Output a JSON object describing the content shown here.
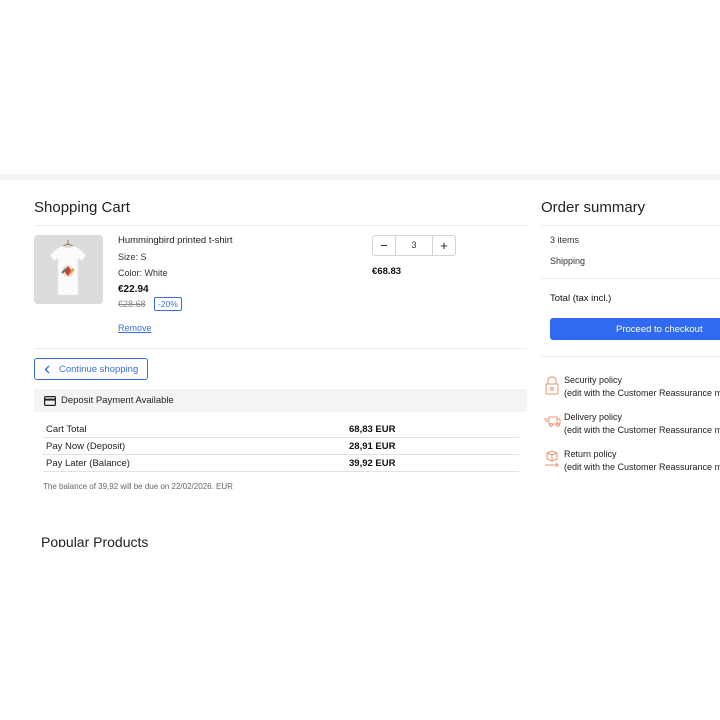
{
  "cart": {
    "title": "Shopping Cart",
    "product": {
      "name": "Hummingbird printed t-shirt",
      "size": "Size: S",
      "color": "Color: White",
      "price": "€22.94",
      "old_price": "€28.68",
      "discount": "-20%",
      "remove_label": "Remove",
      "quantity": "3",
      "line_total": "€68.83",
      "qty_minus": "−",
      "qty_plus": "+"
    },
    "continue_label": "Continue shopping",
    "deposit_label": "Deposit Payment Available",
    "deposit_rows": [
      {
        "label": "Cart Total",
        "value": "68,83 EUR"
      },
      {
        "label": "Pay Now (Deposit)",
        "value": "28,91 EUR"
      },
      {
        "label": "Pay Later (Balance)",
        "value": "39,92 EUR"
      }
    ],
    "balance_note": "The balance of 39,92 will be due on 22/02/2026. EUR"
  },
  "popular": {
    "title": "Popular Products"
  },
  "summary": {
    "title": "Order summary",
    "items": "3 items",
    "shipping": "Shipping",
    "total_label": "Total (tax incl.)",
    "checkout_label": "Proceed to checkout"
  },
  "reassurance": [
    {
      "title": "Security policy",
      "subtitle": "(edit with the Customer Reassurance module)",
      "icon": "lock-icon"
    },
    {
      "title": "Delivery policy",
      "subtitle": "(edit with the Customer Reassurance module)",
      "icon": "truck-icon"
    },
    {
      "title": "Return policy",
      "subtitle": "(edit with the Customer Reassurance module)",
      "icon": "return-icon"
    }
  ],
  "colors": {
    "accent": "#2f6af0",
    "link": "#3a6fd8",
    "icon": "#e8946b"
  }
}
